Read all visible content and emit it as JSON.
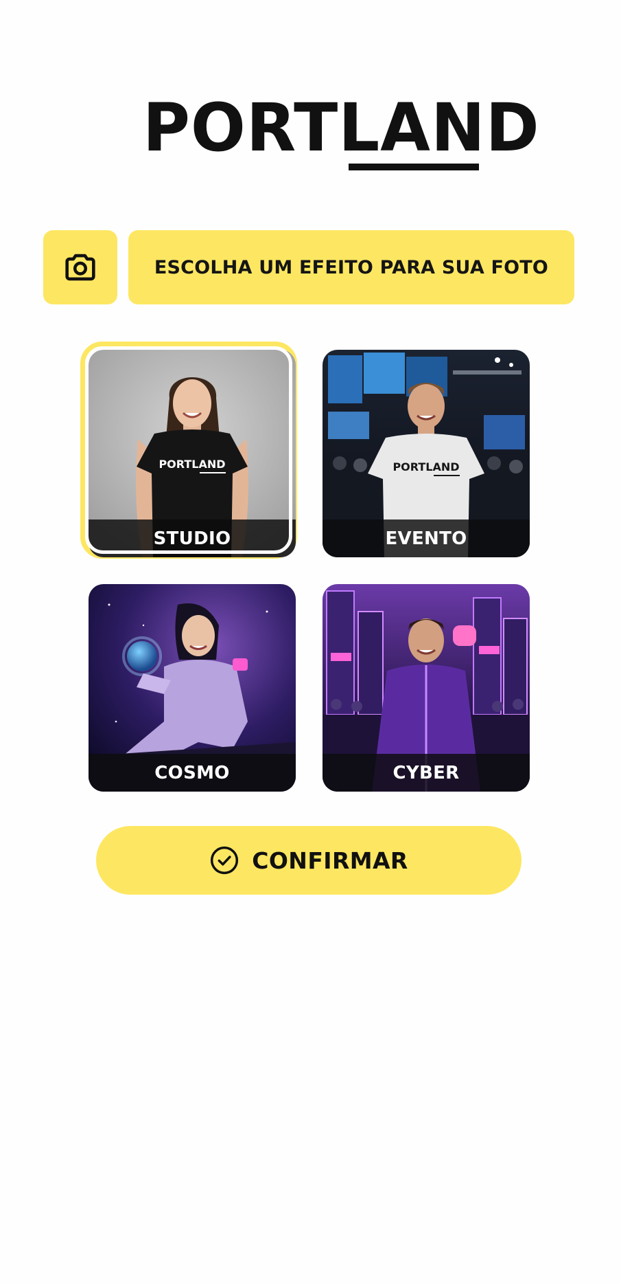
{
  "brand": {
    "logo_text": "PORTLAND",
    "accent_color": "#fde762",
    "text_color": "#111111"
  },
  "header": {
    "camera_icon": "camera-icon",
    "title": "ESCOLHA UM EFEITO PARA SUA FOTO"
  },
  "effects": [
    {
      "id": "studio",
      "label": "STUDIO",
      "selected": true,
      "shirt_text": "PORTLAND"
    },
    {
      "id": "evento",
      "label": "EVENTO",
      "selected": false,
      "shirt_text": "PORTLAND"
    },
    {
      "id": "cosmo",
      "label": "COSMO",
      "selected": false
    },
    {
      "id": "cyber",
      "label": "CYBER",
      "selected": false
    }
  ],
  "confirm": {
    "icon": "check-circle-icon",
    "label": "CONFIRMAR"
  }
}
